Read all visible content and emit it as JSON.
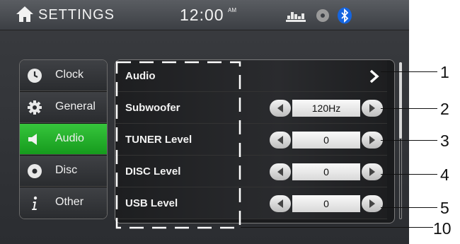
{
  "header": {
    "title": "SETTINGS",
    "time": "12:00",
    "ampm": "AM",
    "icons": [
      "home-icon",
      "equalizer-icon",
      "disc-icon",
      "bluetooth-icon"
    ],
    "bluetooth_color": "#1565e0"
  },
  "sidebar": {
    "items": [
      {
        "label": "Clock",
        "icon": "clock-icon",
        "active": false
      },
      {
        "label": "General",
        "icon": "gear-icon",
        "active": false
      },
      {
        "label": "Audio",
        "icon": "speaker-icon",
        "active": true
      },
      {
        "label": "Disc",
        "icon": "disc-icon",
        "active": false
      },
      {
        "label": "Other",
        "icon": "info-icon",
        "active": false
      }
    ],
    "active_color": "#2bb532"
  },
  "panel": {
    "rows": [
      {
        "label": "Audio",
        "control": "submenu-arrow"
      },
      {
        "label": "Subwoofer",
        "value": "120Hz"
      },
      {
        "label": "TUNER Level",
        "value": "0"
      },
      {
        "label": "DISC Level",
        "value": "0"
      },
      {
        "label": "USB Level",
        "value": "0"
      }
    ]
  },
  "callouts": [
    "1",
    "2",
    "3",
    "4",
    "5",
    "10"
  ]
}
